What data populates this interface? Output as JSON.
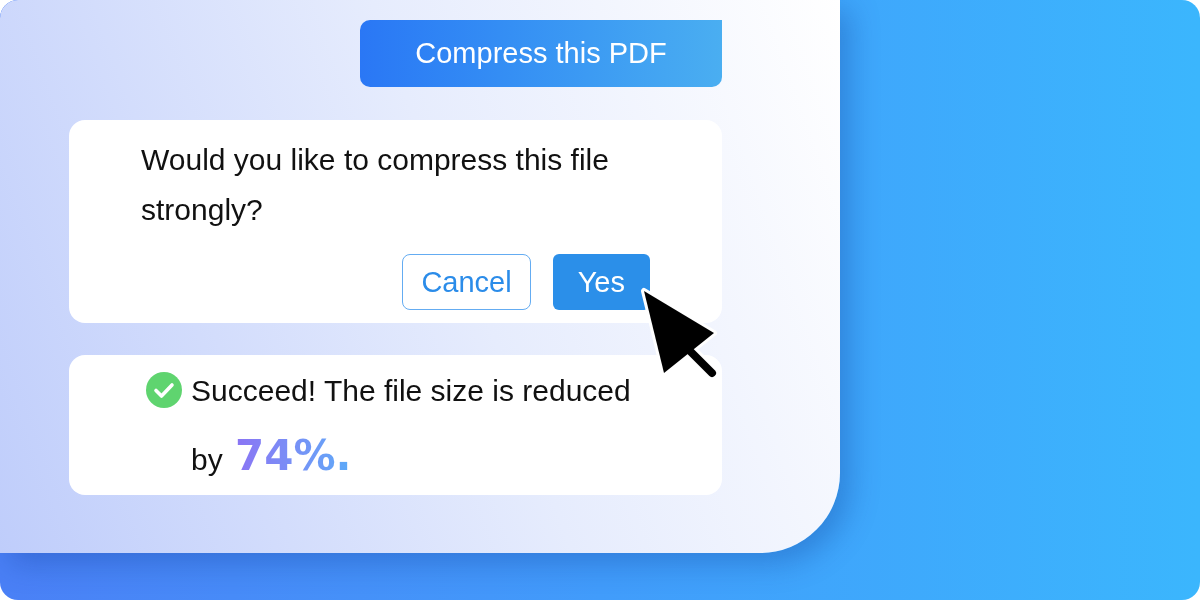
{
  "prompt_button": {
    "label": "Compress this PDF"
  },
  "dialog": {
    "question": "Would you like to compress this file strongly?",
    "buttons": [
      {
        "label": "Cancel",
        "kind": "secondary"
      },
      {
        "label": "Yes",
        "kind": "primary"
      }
    ]
  },
  "result": {
    "message": "Succeed! The file size is reduced by **74%.**"
  }
}
